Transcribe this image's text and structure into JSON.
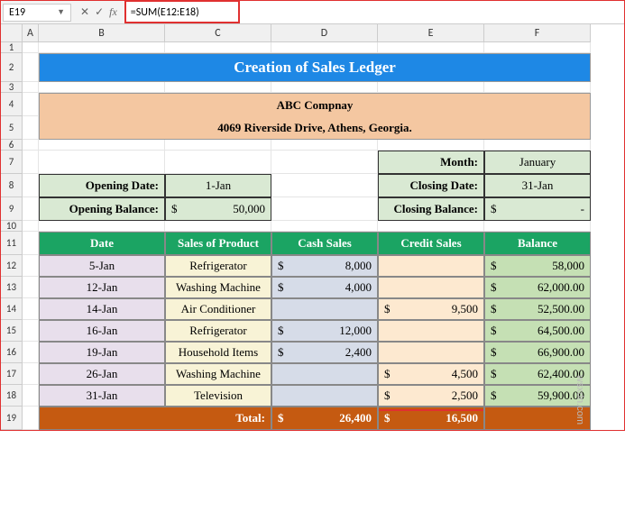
{
  "cell_ref": "E19",
  "formula": "=SUM(E12:E18)",
  "columns": [
    "A",
    "B",
    "C",
    "D",
    "E",
    "F"
  ],
  "rows": [
    "1",
    "2",
    "3",
    "4",
    "5",
    "6",
    "7",
    "8",
    "9",
    "10",
    "11",
    "12",
    "13",
    "14",
    "15",
    "16",
    "17",
    "18",
    "19"
  ],
  "title": "Creation of Sales Ledger",
  "company_name": "ABC Compnay",
  "company_addr": "4069 Riverside Drive, Athens, Georgia.",
  "info": {
    "opening_date_lbl": "Opening Date:",
    "opening_date": "1-Jan",
    "opening_bal_lbl": "Opening Balance:",
    "opening_bal_sym": "$",
    "opening_bal": "50,000",
    "month_lbl": "Month:",
    "month": "January",
    "closing_date_lbl": "Closing Date:",
    "closing_date": "31-Jan",
    "closing_bal_lbl": "Closing Balance:",
    "closing_bal_sym": "$",
    "closing_bal": "-"
  },
  "headers": {
    "date": "Date",
    "product": "Sales of Product",
    "cash": "Cash Sales",
    "credit": "Credit Sales",
    "balance": "Balance"
  },
  "rows_data": [
    {
      "date": "5-Jan",
      "product": "Refrigerator",
      "cash": "8,000",
      "credit": "",
      "bal": "58,000"
    },
    {
      "date": "12-Jan",
      "product": "Washing Machine",
      "cash": "4,000",
      "credit": "",
      "bal": "62,000.00"
    },
    {
      "date": "14-Jan",
      "product": "Air Conditioner",
      "cash": "",
      "credit": "9,500",
      "bal": "52,500.00"
    },
    {
      "date": "16-Jan",
      "product": "Refrigerator",
      "cash": "12,000",
      "credit": "",
      "bal": "64,500.00"
    },
    {
      "date": "19-Jan",
      "product": "Household Items",
      "cash": "2,400",
      "credit": "",
      "bal": "66,900.00"
    },
    {
      "date": "26-Jan",
      "product": "Washing Machine",
      "cash": "",
      "credit": "4,500",
      "bal": "62,400.00"
    },
    {
      "date": "31-Jan",
      "product": "Television",
      "cash": "",
      "credit": "2,500",
      "bal": "59,900.00"
    }
  ],
  "totals": {
    "label": "Total:",
    "cash": "26,400",
    "credit": "16,500"
  },
  "sym": "$",
  "watermark": "wsxdn.com"
}
